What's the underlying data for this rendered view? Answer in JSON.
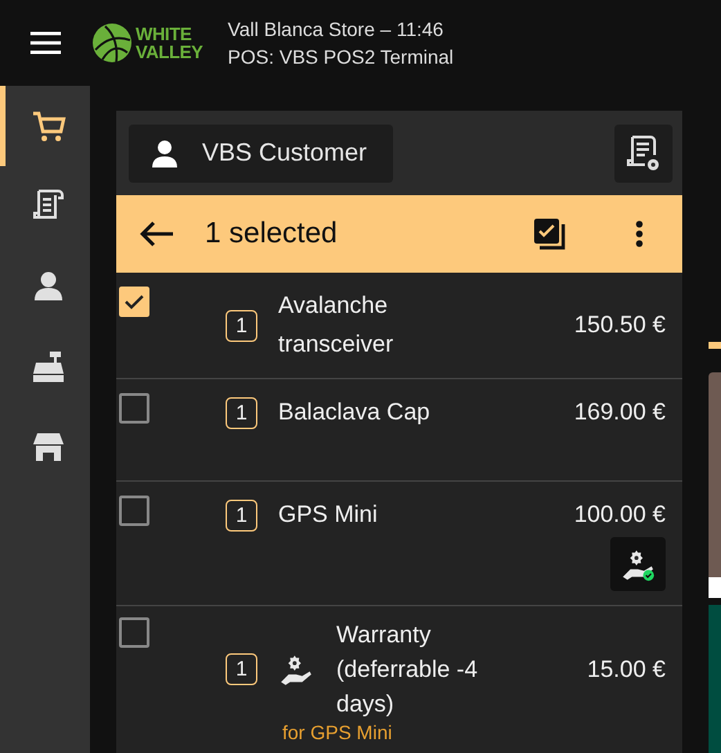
{
  "header": {
    "logo_text": [
      "WHITE",
      "VALLEY"
    ],
    "store_line": "Vall Blanca Store – 11:46",
    "terminal_line": "POS: VBS POS2 Terminal"
  },
  "sidebar": {
    "items": [
      {
        "kind": "cart",
        "selected": true
      },
      {
        "kind": "receipt",
        "selected": false
      },
      {
        "kind": "person",
        "selected": false
      },
      {
        "kind": "register",
        "selected": false
      },
      {
        "kind": "store",
        "selected": false
      }
    ]
  },
  "ticket": {
    "customer": "VBS Customer",
    "selection_bar": {
      "title": "1 selected"
    },
    "lines": [
      {
        "kind": "product",
        "checked": true,
        "qty": "1",
        "name": "Avalanche transceiver",
        "price": "150.50 €",
        "service_icon": false
      },
      {
        "kind": "product",
        "checked": false,
        "qty": "1",
        "name": "Balaclava Cap",
        "price": "169.00 €",
        "service_icon": false
      },
      {
        "kind": "product",
        "checked": false,
        "qty": "1",
        "name": "GPS Mini",
        "price": "100.00 €",
        "service_icon": true
      },
      {
        "kind": "service",
        "checked": false,
        "qty": "1",
        "name": "Warranty (deferrable -4 days)",
        "price": "15.00 €",
        "note": "for GPS Mini"
      }
    ]
  }
}
